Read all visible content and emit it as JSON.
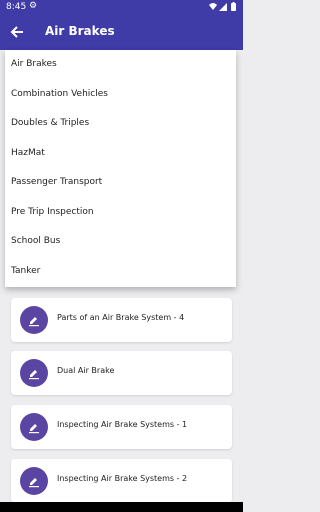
{
  "status": {
    "time": "8:45"
  },
  "appbar": {
    "title": "Air Brakes"
  },
  "menu": {
    "items": [
      "Air Brakes",
      "Combination Vehicles",
      "Doubles & Triples",
      "HazMat",
      "Passenger Transport",
      "Pre Trip Inspection",
      "School Bus",
      "Tanker"
    ]
  },
  "lessons": [
    {
      "title": "Parts of an Air Brake System - 4"
    },
    {
      "title": "Dual Air Brake"
    },
    {
      "title": "Inspecting Air Brake Systems - 1"
    },
    {
      "title": "Inspecting Air Brake Systems - 2"
    }
  ],
  "colors": {
    "primary": "#3f3ba7",
    "icon_bg": "#5b45a3"
  }
}
